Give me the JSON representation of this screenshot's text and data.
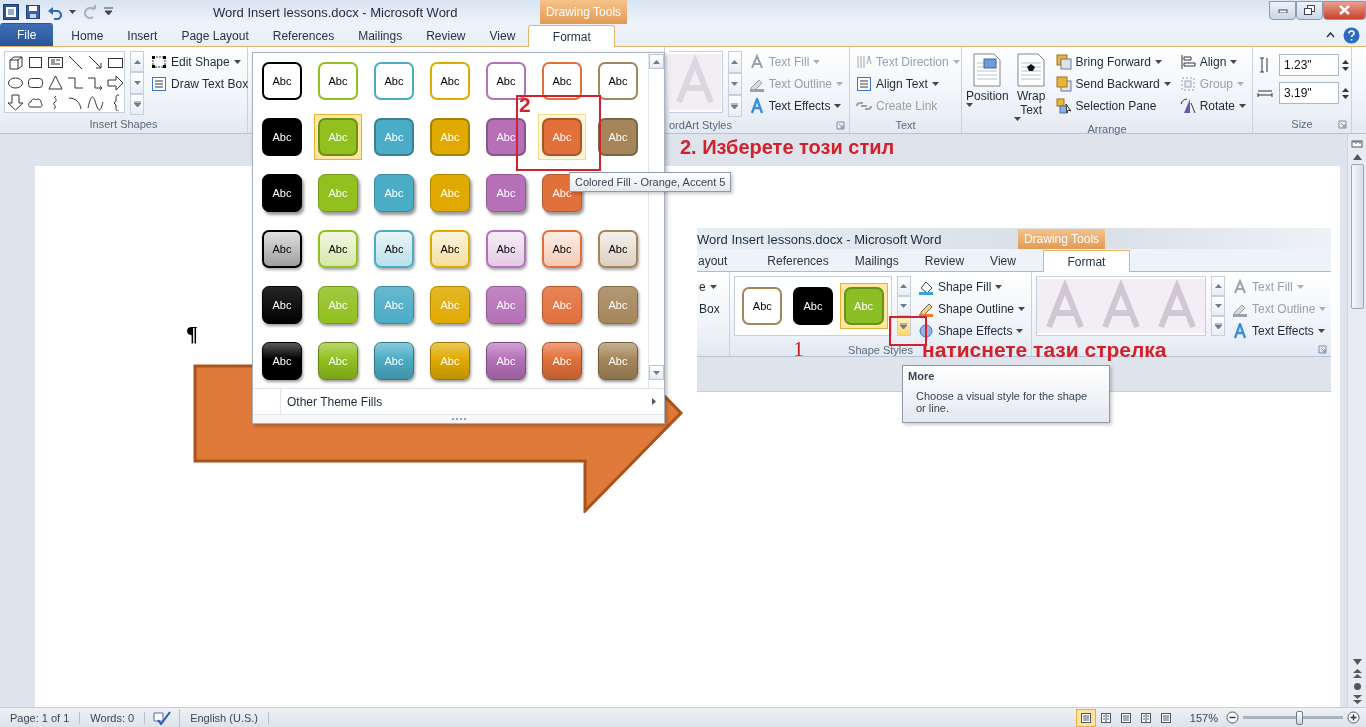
{
  "title_bar": {
    "title": "Word Insert lessons.docx  -  Microsoft Word",
    "contextual_tab": "Drawing Tools"
  },
  "tabs": [
    {
      "label": "File",
      "kind": "file",
      "selected": false
    },
    {
      "label": "Home",
      "kind": "tab",
      "selected": false
    },
    {
      "label": "Insert",
      "kind": "tab",
      "selected": false
    },
    {
      "label": "Page Layout",
      "kind": "tab",
      "selected": false
    },
    {
      "label": "References",
      "kind": "tab",
      "selected": false
    },
    {
      "label": "Mailings",
      "kind": "tab",
      "selected": false
    },
    {
      "label": "Review",
      "kind": "tab",
      "selected": false
    },
    {
      "label": "View",
      "kind": "tab",
      "selected": false
    },
    {
      "label": "Format",
      "kind": "tab",
      "selected": true
    }
  ],
  "ribbon": {
    "insert_shapes": {
      "commands": [
        {
          "label": "Edit Shape",
          "dropdown": true
        },
        {
          "label": "Draw Text Box",
          "dropdown": false
        }
      ],
      "group_label": "Insert Shapes"
    },
    "wordart": {
      "commands": [
        {
          "label": "Text Fill",
          "dropdown": true,
          "disabled": true
        },
        {
          "label": "Text Outline",
          "dropdown": true,
          "disabled": true
        },
        {
          "label": "Text Effects",
          "dropdown": true,
          "disabled": false
        }
      ],
      "group_label": "ordArt Styles"
    },
    "text": {
      "commands": [
        {
          "label": "Text Direction",
          "dropdown": true,
          "disabled": true
        },
        {
          "label": "Align Text",
          "dropdown": true,
          "disabled": false
        },
        {
          "label": "Create Link",
          "dropdown": false,
          "disabled": true
        }
      ],
      "group_label": "Text"
    },
    "arrange": {
      "large": [
        {
          "label": "Position"
        },
        {
          "label": "Wrap Text"
        }
      ],
      "commands": [
        {
          "label": "Bring Forward",
          "dropdown": true,
          "disabled": false
        },
        {
          "label": "Send Backward",
          "dropdown": true,
          "disabled": false
        },
        {
          "label": "Selection Pane",
          "dropdown": false,
          "disabled": false
        },
        {
          "label": "Align",
          "dropdown": true,
          "disabled": false
        },
        {
          "label": "Group",
          "dropdown": true,
          "disabled": true
        },
        {
          "label": "Rotate",
          "dropdown": true,
          "disabled": false
        }
      ],
      "group_label": "Arrange"
    },
    "size": {
      "fields": [
        {
          "value": "1.23\""
        },
        {
          "value": "3.19\""
        }
      ],
      "group_label": "Size"
    }
  },
  "style_gallery": {
    "rows": [
      {
        "kind": "outline",
        "swatches": [
          {
            "label": "Abc",
            "color": "#000000",
            "selected": false,
            "highlighted": false
          },
          {
            "label": "Abc",
            "color": "#92c01f",
            "selected": false,
            "highlighted": false
          },
          {
            "label": "Abc",
            "color": "#4bacc6",
            "selected": false,
            "highlighted": false
          },
          {
            "label": "Abc",
            "color": "#e0aa00",
            "selected": false,
            "highlighted": false
          },
          {
            "label": "Abc",
            "color": "#b570b8",
            "selected": false,
            "highlighted": false
          },
          {
            "label": "Abc",
            "color": "#e2703a",
            "selected": false,
            "highlighted": false
          },
          {
            "label": "Abc",
            "color": "#a5865b",
            "selected": false,
            "highlighted": false
          }
        ]
      },
      {
        "kind": "fill",
        "swatches": [
          {
            "label": "Abc",
            "color": "#000000",
            "selected": false,
            "highlighted": false
          },
          {
            "label": "Abc",
            "color": "#92c01f",
            "selected": true,
            "highlighted": false
          },
          {
            "label": "Abc",
            "color": "#4bacc6",
            "selected": false,
            "highlighted": false
          },
          {
            "label": "Abc",
            "color": "#e0aa00",
            "selected": false,
            "highlighted": false
          },
          {
            "label": "Abc",
            "color": "#b570b8",
            "selected": false,
            "highlighted": false
          },
          {
            "label": "Abc",
            "color": "#e2703a",
            "selected": false,
            "highlighted": true
          },
          {
            "label": "Abc",
            "color": "#a5865b",
            "selected": false,
            "highlighted": false
          }
        ]
      },
      {
        "kind": "shadow",
        "swatches": [
          {
            "label": "Abc",
            "color": "#000000",
            "selected": false,
            "highlighted": false
          },
          {
            "label": "Abc",
            "color": "#92c01f",
            "selected": false,
            "highlighted": false
          },
          {
            "label": "Abc",
            "color": "#4bacc6",
            "selected": false,
            "highlighted": false
          },
          {
            "label": "Abc",
            "color": "#e0aa00",
            "selected": false,
            "highlighted": false
          },
          {
            "label": "Abc",
            "color": "#b570b8",
            "selected": false,
            "highlighted": false
          },
          {
            "label": "Abc",
            "color": "#e2703a",
            "selected": false,
            "highlighted": false
          }
        ]
      },
      {
        "kind": "light",
        "swatches": [
          {
            "label": "Abc",
            "color": "#000000",
            "selected": false,
            "highlighted": false
          },
          {
            "label": "Abc",
            "color": "#92c01f",
            "selected": false,
            "highlighted": false
          },
          {
            "label": "Abc",
            "color": "#4bacc6",
            "selected": false,
            "highlighted": false
          },
          {
            "label": "Abc",
            "color": "#e0aa00",
            "selected": false,
            "highlighted": false
          },
          {
            "label": "Abc",
            "color": "#b570b8",
            "selected": false,
            "highlighted": false
          },
          {
            "label": "Abc",
            "color": "#e2703a",
            "selected": false,
            "highlighted": false
          },
          {
            "label": "Abc",
            "color": "#a5865b",
            "selected": false,
            "highlighted": false
          }
        ]
      },
      {
        "kind": "intense",
        "swatches": [
          {
            "label": "Abc",
            "color": "#000000",
            "selected": false,
            "highlighted": false
          },
          {
            "label": "Abc",
            "color": "#92c01f",
            "selected": false,
            "highlighted": false
          },
          {
            "label": "Abc",
            "color": "#4bacc6",
            "selected": false,
            "highlighted": false
          },
          {
            "label": "Abc",
            "color": "#e0aa00",
            "selected": false,
            "highlighted": false
          },
          {
            "label": "Abc",
            "color": "#b570b8",
            "selected": false,
            "highlighted": false
          },
          {
            "label": "Abc",
            "color": "#e2703a",
            "selected": false,
            "highlighted": false
          },
          {
            "label": "Abc",
            "color": "#a5865b",
            "selected": false,
            "highlighted": false
          }
        ]
      },
      {
        "kind": "bevel",
        "swatches": [
          {
            "label": "Abc",
            "color": "#000000",
            "selected": false,
            "highlighted": false
          },
          {
            "label": "Abc",
            "color": "#92c01f",
            "selected": false,
            "highlighted": false
          },
          {
            "label": "Abc",
            "color": "#4bacc6",
            "selected": false,
            "highlighted": false
          },
          {
            "label": "Abc",
            "color": "#e0aa00",
            "selected": false,
            "highlighted": false
          },
          {
            "label": "Abc",
            "color": "#b570b8",
            "selected": false,
            "highlighted": false
          },
          {
            "label": "Abc",
            "color": "#e2703a",
            "selected": false,
            "highlighted": false
          },
          {
            "label": "Abc",
            "color": "#a5865b",
            "selected": false,
            "highlighted": false
          }
        ]
      }
    ],
    "menu_item": "Other Theme Fills"
  },
  "screen_tip": "Colored Fill - Orange, Accent 5",
  "annotations": {
    "step_2_marker": "2",
    "step_2": "2. Изберете този стил",
    "step_1_marker": "1",
    "step_1": "натиснете тази стрелка"
  },
  "document": {
    "paragraph_mark": "¶"
  },
  "inset": {
    "title": "Word Insert lessons.docx  -  Microsoft Word",
    "contextual_tab": "Drawing Tools",
    "tabs": [
      {
        "label": "ayout",
        "selected": false
      },
      {
        "label": "References",
        "selected": false
      },
      {
        "label": "Mailings",
        "selected": false
      },
      {
        "label": "Review",
        "selected": false
      },
      {
        "label": "View",
        "selected": false
      },
      {
        "label": "Format",
        "selected": true
      }
    ],
    "partial_commands": [
      {
        "label": "e",
        "dropdown": true
      },
      {
        "label": "Box",
        "dropdown": false
      }
    ],
    "swatches": [
      {
        "label": "Abc",
        "kind": "outline",
        "color": "#a5865b",
        "selected": false
      },
      {
        "label": "Abc",
        "kind": "fill",
        "color": "#000000",
        "selected": false
      },
      {
        "label": "Abc",
        "kind": "fill",
        "color": "#8cbf26",
        "selected": true
      }
    ],
    "shape_commands": [
      {
        "label": "Shape Fill",
        "dropdown": true
      },
      {
        "label": "Shape Outline",
        "dropdown": true
      },
      {
        "label": "Shape Effects",
        "dropdown": true
      }
    ],
    "group_label": "Shape Styles",
    "wordart_commands": [
      {
        "label": "Text Fill",
        "dropdown": true,
        "disabled": true
      },
      {
        "label": "Text Outline",
        "dropdown": true,
        "disabled": true
      },
      {
        "label": "Text Effects",
        "dropdown": true,
        "disabled": false
      }
    ],
    "tooltip": {
      "title": "More",
      "text": "Choose a visual style for the shape or line."
    }
  },
  "status_bar": {
    "page": "Page: 1 of 1",
    "words": "Words: 0",
    "language": "English (U.S.)",
    "views": [
      {
        "selected": true
      },
      {
        "selected": false
      },
      {
        "selected": false
      },
      {
        "selected": false
      },
      {
        "selected": false
      }
    ],
    "zoom": "157%",
    "zoom_slider": {
      "level": 0.56
    }
  }
}
